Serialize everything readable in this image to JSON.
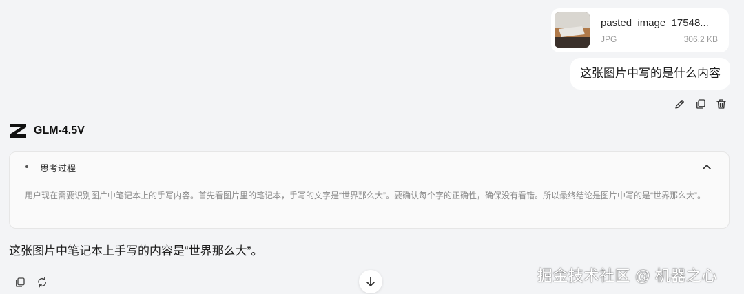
{
  "attachment": {
    "filename": "pasted_image_17548...",
    "type": "JPG",
    "size": "306.2 KB"
  },
  "user_message": "这张图片中写的是什么内容",
  "user_actions": [
    "edit-icon",
    "copy-icon",
    "trash-icon"
  ],
  "model": {
    "name": "GLM-4.5V",
    "logo_icon": "z-logo-icon"
  },
  "thinking": {
    "title": "思考过程",
    "content": "用户现在需要识别图片中笔记本上的手写内容。首先看图片里的笔记本，手写的文字是“世界那么大”。要确认每个字的正确性，确保没有看错。所以最终结论是图片中写的是“世界那么大”。",
    "toggle_icon": "chevron-up-icon"
  },
  "answer": "这张图片中笔记本上手写的内容是“世界那么大”。",
  "answer_actions": [
    "copy-icon",
    "refresh-icon"
  ],
  "scroll_button_icon": "arrow-down-icon",
  "watermark": "掘金技术社区 @ 机器之心"
}
